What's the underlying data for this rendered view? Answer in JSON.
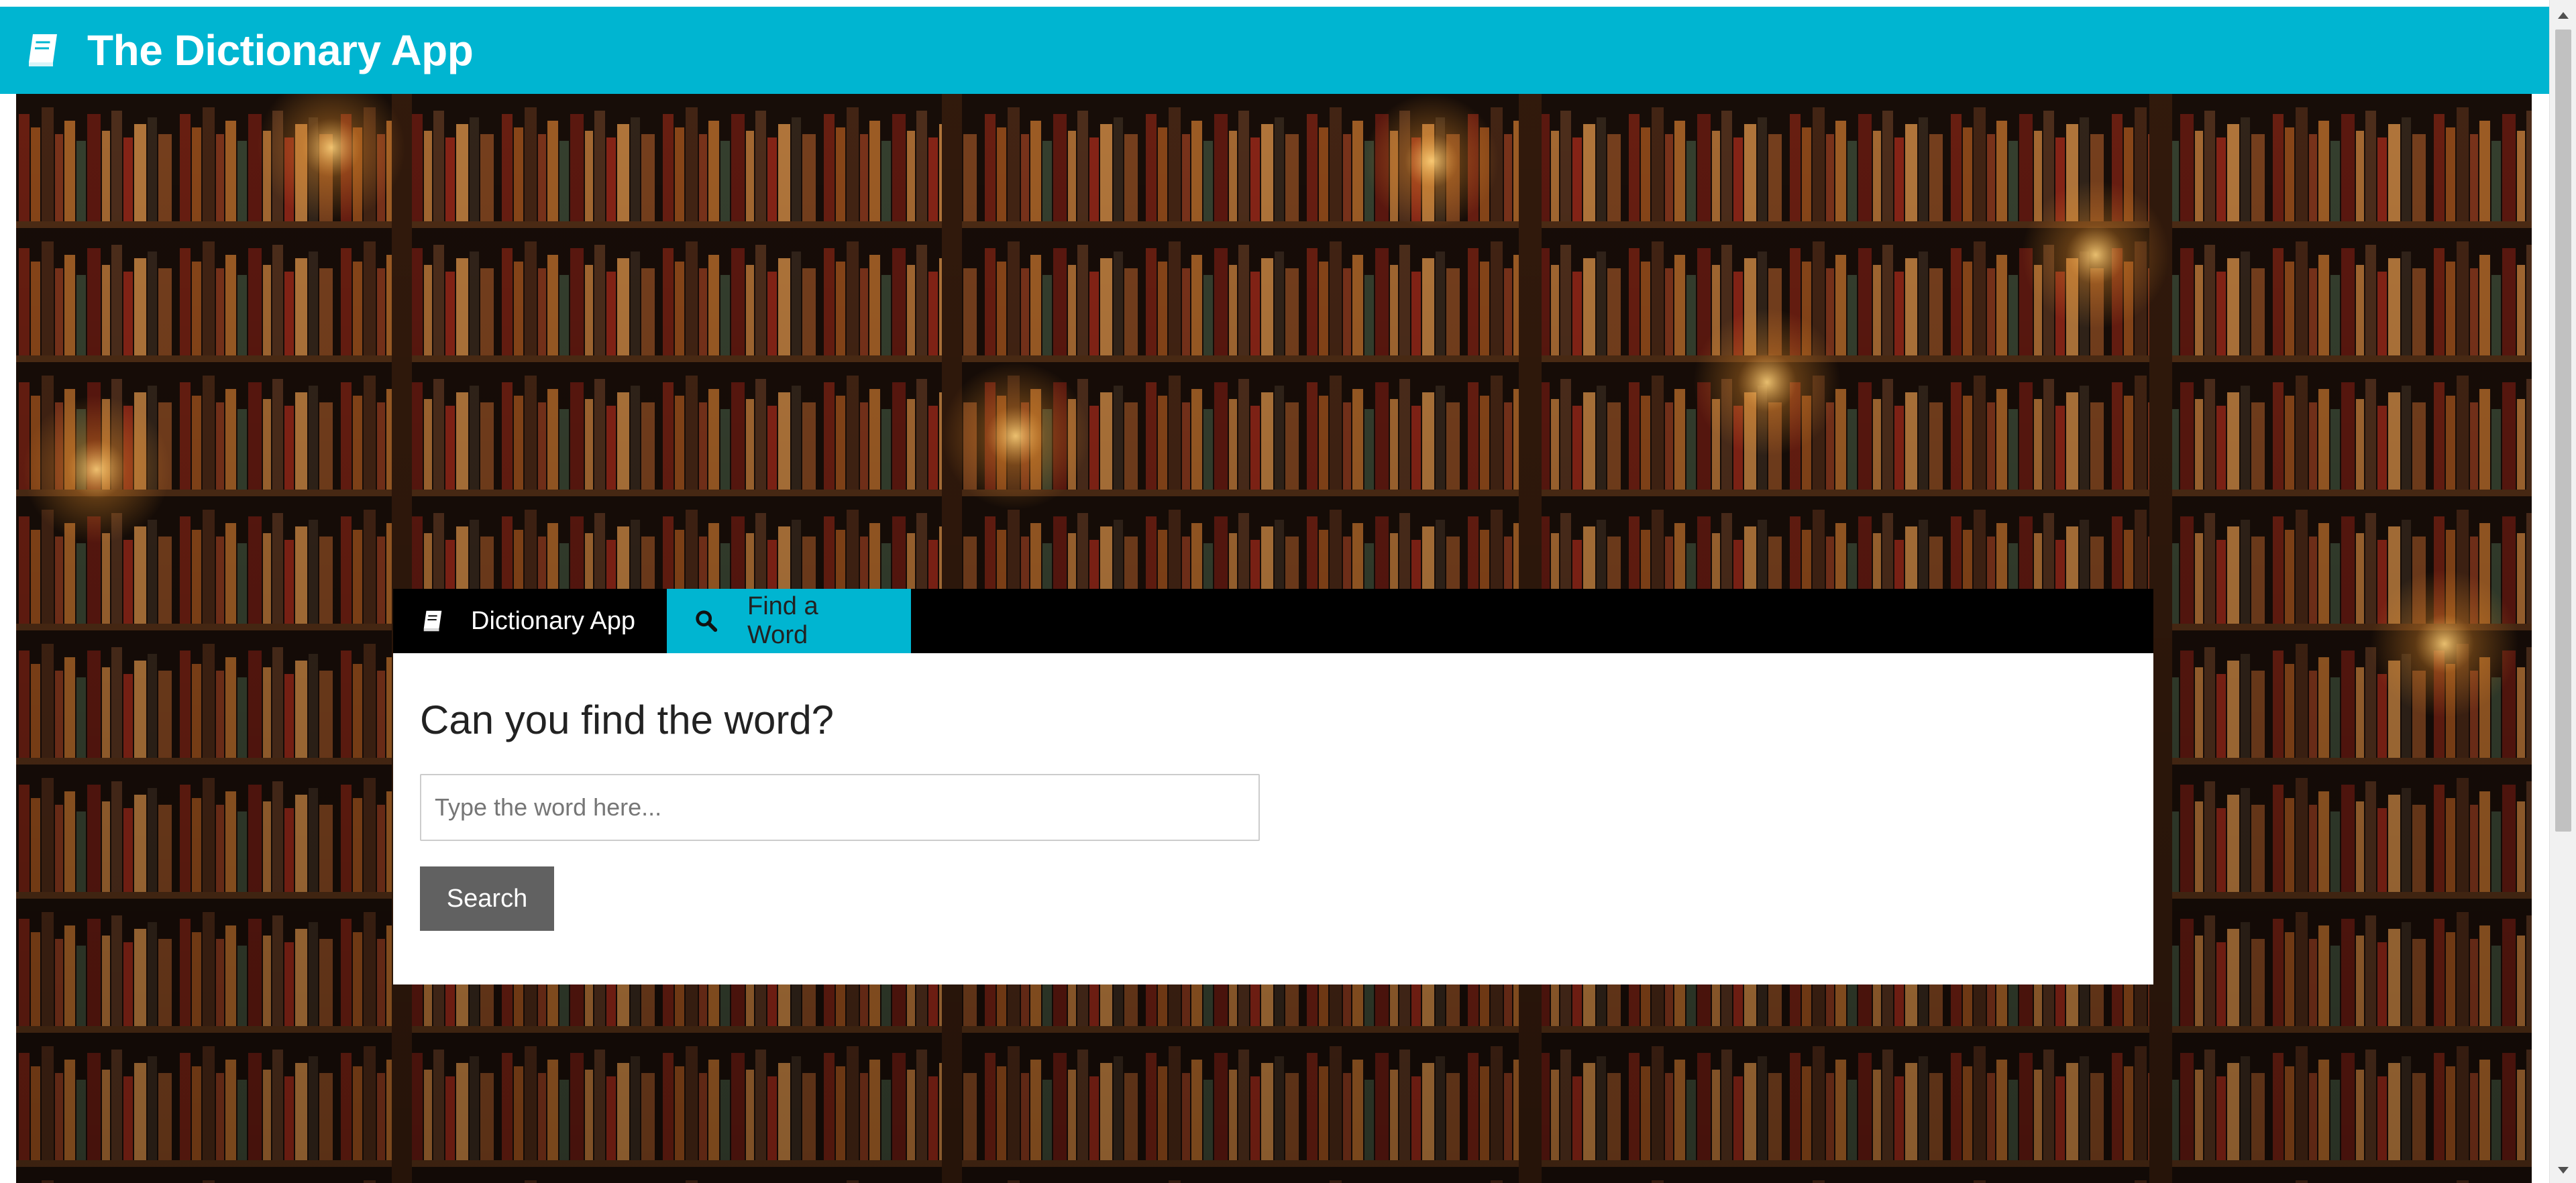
{
  "app": {
    "title": "The Dictionary App",
    "icon": "book-icon",
    "brand_color": "#00b5d1"
  },
  "nav": {
    "tabs": [
      {
        "label": "Dictionary App",
        "icon": "book-icon",
        "active": false
      },
      {
        "label": "Find a Word",
        "icon": "search-icon",
        "active": true
      }
    ]
  },
  "search": {
    "heading": "Can you find the word?",
    "placeholder": "Type the word here...",
    "value": "",
    "button_label": "Search",
    "button_color": "#616161"
  },
  "background": {
    "image": "bookshelf-candles",
    "palette": [
      "#1a0d07",
      "#5a2a12",
      "#8b3a1a",
      "#b5651d"
    ]
  }
}
